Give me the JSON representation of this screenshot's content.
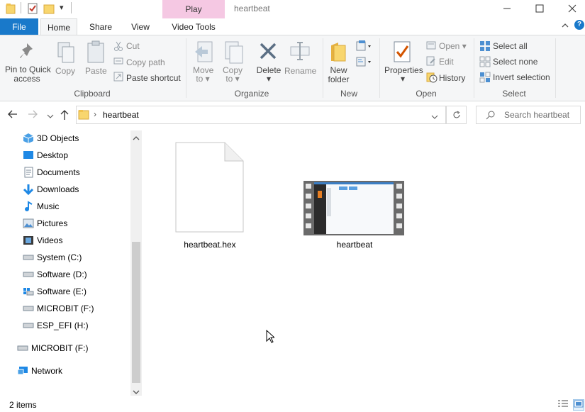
{
  "window": {
    "title": "heartbeat",
    "context_tab_header": "Play",
    "controls": [
      "minimize",
      "maximize",
      "close"
    ]
  },
  "tabs": {
    "file": "File",
    "home": "Home",
    "share": "Share",
    "view": "View",
    "video_tools": "Video Tools"
  },
  "ribbon": {
    "clipboard": {
      "pin": "Pin to Quick",
      "pin2": "access",
      "copy": "Copy",
      "paste": "Paste",
      "cut": "Cut",
      "copy_path": "Copy path",
      "paste_shortcut": "Paste shortcut",
      "group": "Clipboard"
    },
    "organize": {
      "move_to": "Move",
      "move_to2": "to",
      "copy_to": "Copy",
      "copy_to2": "to",
      "delete": "Delete",
      "rename": "Rename",
      "group": "Organize"
    },
    "new": {
      "new_folder": "New",
      "new_folder2": "folder",
      "group": "New"
    },
    "open": {
      "properties": "Properties",
      "open": "Open",
      "edit": "Edit",
      "history": "History",
      "group": "Open"
    },
    "select": {
      "select_all": "Select all",
      "select_none": "Select none",
      "invert": "Invert selection",
      "group": "Select"
    }
  },
  "address": {
    "path": "heartbeat",
    "search_placeholder": "Search heartbeat"
  },
  "nav": {
    "items": [
      {
        "label": "3D Objects",
        "icon": "3d-objects-icon"
      },
      {
        "label": "Desktop",
        "icon": "desktop-icon"
      },
      {
        "label": "Documents",
        "icon": "documents-icon"
      },
      {
        "label": "Downloads",
        "icon": "downloads-icon"
      },
      {
        "label": "Music",
        "icon": "music-icon"
      },
      {
        "label": "Pictures",
        "icon": "pictures-icon"
      },
      {
        "label": "Videos",
        "icon": "videos-icon"
      },
      {
        "label": "System (C:)",
        "icon": "drive-icon"
      },
      {
        "label": "Software (D:)",
        "icon": "drive-icon"
      },
      {
        "label": "Software (E:)",
        "icon": "network-drive-icon"
      },
      {
        "label": "MICROBIT (F:)",
        "icon": "drive-icon"
      },
      {
        "label": "ESP_EFI (H:)",
        "icon": "drive-icon"
      },
      {
        "label": "MICROBIT (F:)",
        "icon": "drive-icon"
      },
      {
        "label": "Network",
        "icon": "network-icon"
      }
    ]
  },
  "files": [
    {
      "name": "heartbeat.hex",
      "type": "blank-file"
    },
    {
      "name": "heartbeat",
      "type": "video"
    }
  ],
  "status": {
    "count": "2 items"
  },
  "colors": {
    "accent": "#1979ca",
    "context_tab": "#f5c8e3"
  }
}
